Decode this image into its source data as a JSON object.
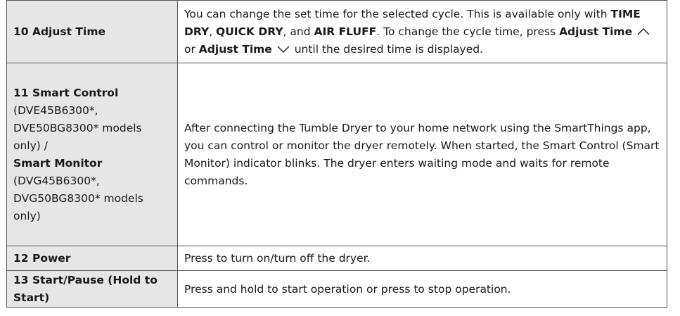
{
  "rows": [
    {
      "label": "10 Adjust Time",
      "desc": {
        "t1": "You can change the set time for the selected cycle. This is available only with ",
        "b1": "TIME DRY",
        "t2": ", ",
        "b2": "QUICK DRY",
        "t3": ", and ",
        "b3": "AIR FLUFF",
        "t4": ". To change the cycle time, press ",
        "b4": "Adjust Time",
        "icon1": "chevron-up-icon",
        "t5": " or ",
        "b5": "Adjust Time",
        "icon2": "chevron-down-icon",
        "t6": " until the desired time is displayed."
      }
    },
    {
      "label_bold1": "11 Smart Control",
      "label_l2": "(DVE45B6300*,",
      "label_l3": "DVE50BG8300* models",
      "label_l4": "only) /",
      "label_bold2": "Smart Monitor",
      "label_l6": "(DVG45B6300*,",
      "label_l7": "DVG50BG8300* models",
      "label_l8": "only)",
      "desc": "After connecting the Tumble Dryer to your home network using the SmartThings app, you can control or monitor the dryer remotely. When started, the Smart Control (Smart Monitor) indicator blinks. The dryer enters waiting mode and waits for remote commands."
    },
    {
      "label": "12 Power",
      "desc": "Press to turn on/turn off the dryer."
    },
    {
      "label": "13 Start/Pause (Hold to Start)",
      "desc": "Press and hold to start operation or press to stop operation."
    }
  ],
  "colors": {
    "label_bg": "#e6e6e6",
    "border": "#555555",
    "text": "#1a1a1a"
  }
}
